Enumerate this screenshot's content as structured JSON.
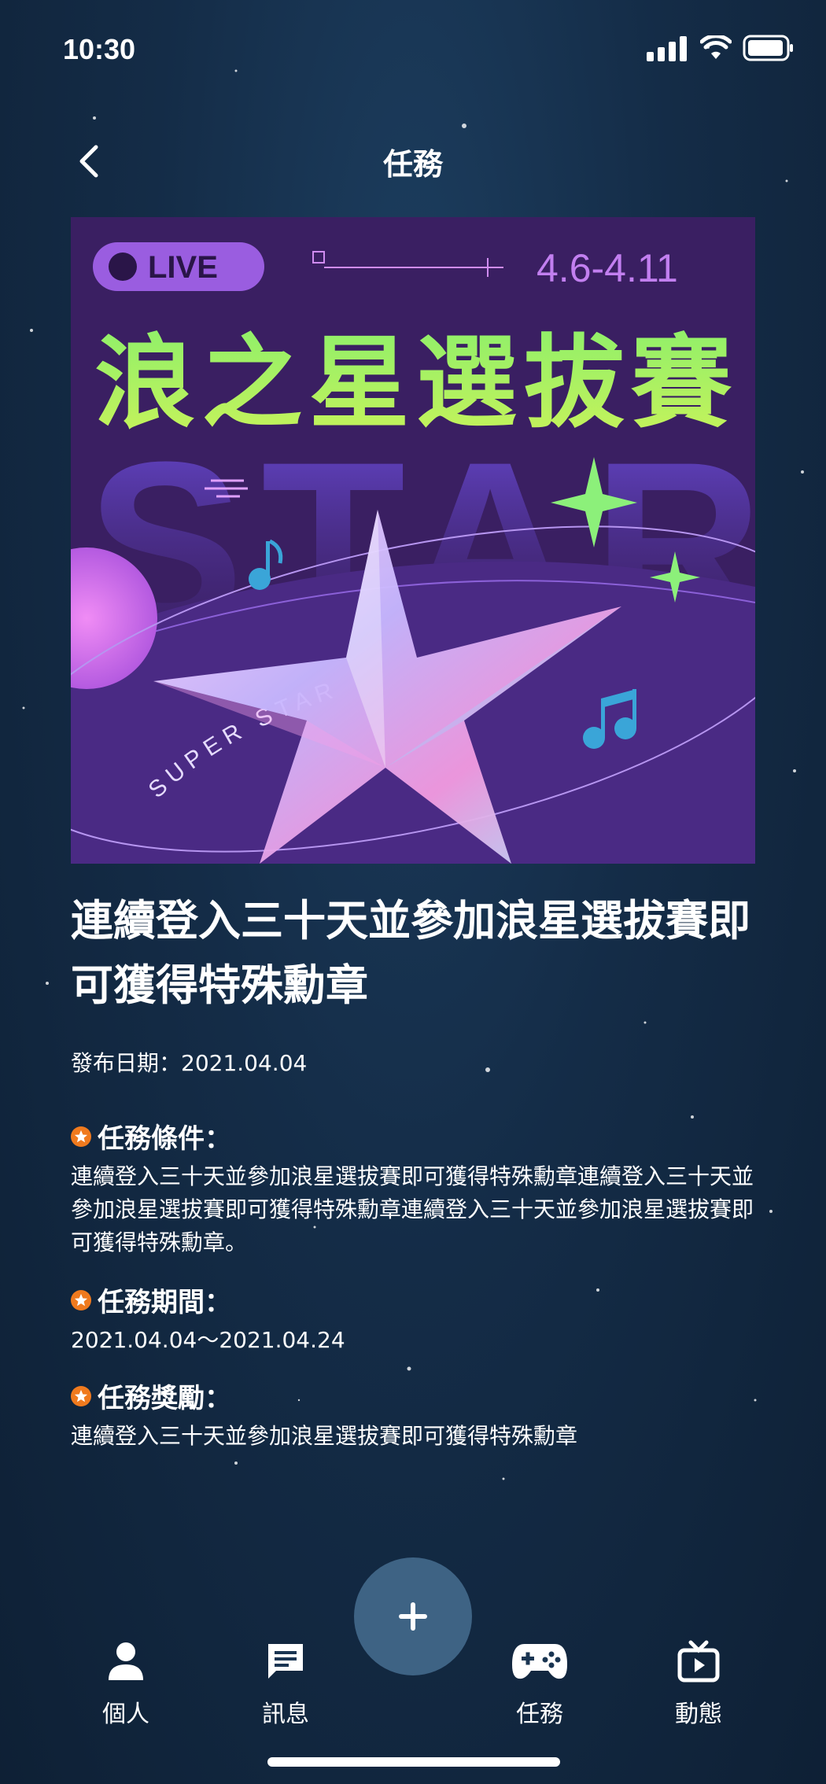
{
  "status_bar": {
    "time": "10:30"
  },
  "header": {
    "title": "任務"
  },
  "banner": {
    "live_label": "LIVE",
    "date_range": "4.6-4.11",
    "headline": "浪之星選拔賽",
    "bg_word": "STAR",
    "ring_text": "SUPER STAR",
    "accent_colors": {
      "bg": "#3a1f62",
      "green": "#a6f25a",
      "purple": "#9a5de0",
      "pink": "#e070e0"
    }
  },
  "task": {
    "title": "連續登入三十天並參加浪星選拔賽即可獲得特殊勳章",
    "publish_date": "發布日期：2021.04.04",
    "conditions_heading": "任務條件：",
    "conditions_body": "連續登入三十天並參加浪星選拔賽即可獲得特殊勳章連續登入三十天並參加浪星選拔賽即可獲得特殊勳章連續登入三十天並參加浪星選拔賽即可獲得特殊勳章。",
    "period_heading": "任務期間：",
    "period_body": "2021.04.04～2021.04.24",
    "reward_heading": "任務獎勵：",
    "reward_body": "連續登入三十天並參加浪星選拔賽即可獲得特殊勳章"
  },
  "bottom_nav": {
    "items": [
      {
        "label": "個人",
        "icon": "person-icon"
      },
      {
        "label": "訊息",
        "icon": "message-icon"
      },
      {
        "label": "任務",
        "icon": "gamepad-icon"
      },
      {
        "label": "動態",
        "icon": "tv-icon"
      }
    ],
    "fab_icon": "plus-icon"
  },
  "colors": {
    "accent_orange": "#f07a1e",
    "fab": "#3e6384"
  }
}
